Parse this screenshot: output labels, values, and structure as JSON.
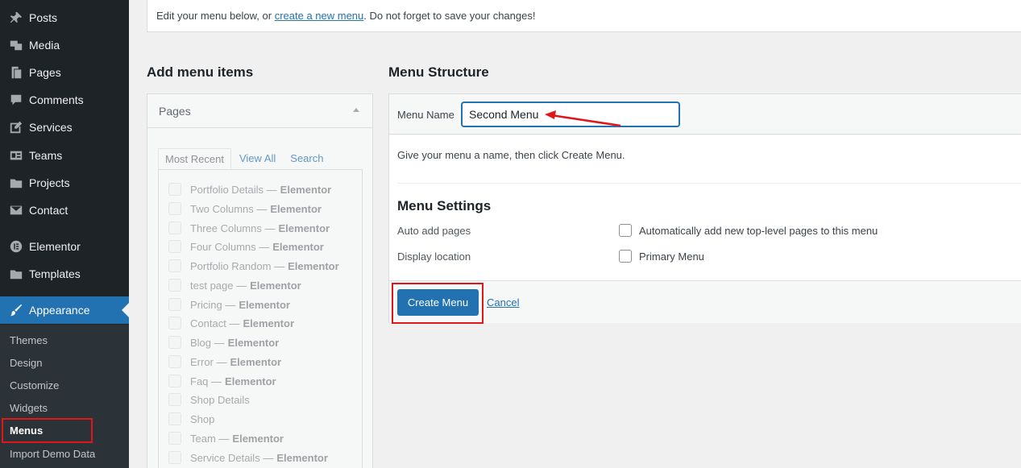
{
  "sidebar": {
    "items": [
      {
        "label": "Posts",
        "icon": "pin-icon"
      },
      {
        "label": "Media",
        "icon": "media-icon"
      },
      {
        "label": "Pages",
        "icon": "pages-icon"
      },
      {
        "label": "Comments",
        "icon": "comments-icon"
      },
      {
        "label": "Services",
        "icon": "edit-icon"
      },
      {
        "label": "Teams",
        "icon": "id-card-icon"
      },
      {
        "label": "Projects",
        "icon": "folder-icon"
      },
      {
        "label": "Contact",
        "icon": "envelope-icon"
      },
      {
        "label": "Elementor",
        "icon": "elementor-icon"
      },
      {
        "label": "Templates",
        "icon": "folder-icon"
      },
      {
        "label": "Appearance",
        "icon": "brush-icon"
      }
    ],
    "submenu": [
      "Themes",
      "Design",
      "Customize",
      "Widgets",
      "Menus",
      "Import Demo Data"
    ]
  },
  "notice": {
    "before": "Edit your menu below, or ",
    "link": "create a new menu",
    "after": ". Do not forget to save your changes!"
  },
  "add_items": {
    "title": "Add menu items",
    "box_title": "Pages",
    "tabs": [
      "Most Recent",
      "View All",
      "Search"
    ],
    "pages": [
      {
        "name": "Portfolio Details",
        "suffix": "Elementor"
      },
      {
        "name": "Two Columns",
        "suffix": "Elementor"
      },
      {
        "name": "Three Columns",
        "suffix": "Elementor"
      },
      {
        "name": "Four Columns",
        "suffix": "Elementor"
      },
      {
        "name": "Portfolio Random",
        "suffix": "Elementor"
      },
      {
        "name": "test page",
        "suffix": "Elementor"
      },
      {
        "name": "Pricing",
        "suffix": "Elementor"
      },
      {
        "name": "Contact",
        "suffix": "Elementor"
      },
      {
        "name": "Blog",
        "suffix": "Elementor"
      },
      {
        "name": "Error",
        "suffix": "Elementor"
      },
      {
        "name": "Faq",
        "suffix": "Elementor"
      },
      {
        "name": "Shop Details",
        "suffix": ""
      },
      {
        "name": "Shop",
        "suffix": ""
      },
      {
        "name": "Team",
        "suffix": "Elementor"
      },
      {
        "name": "Service Details",
        "suffix": "Elementor"
      }
    ]
  },
  "structure": {
    "title": "Menu Structure",
    "name_label": "Menu Name",
    "name_value": "Second Menu",
    "hint": "Give your menu a name, then click Create Menu.",
    "settings_title": "Menu Settings",
    "auto_add_label": "Auto add pages",
    "auto_add_option": "Automatically add new top-level pages to this menu",
    "location_label": "Display location",
    "location_option": "Primary Menu",
    "create_button": "Create Menu",
    "cancel_link": "Cancel"
  },
  "colors": {
    "accent": "#2271b1",
    "sidebar": "#1d2327",
    "highlight": "#e0161b"
  }
}
